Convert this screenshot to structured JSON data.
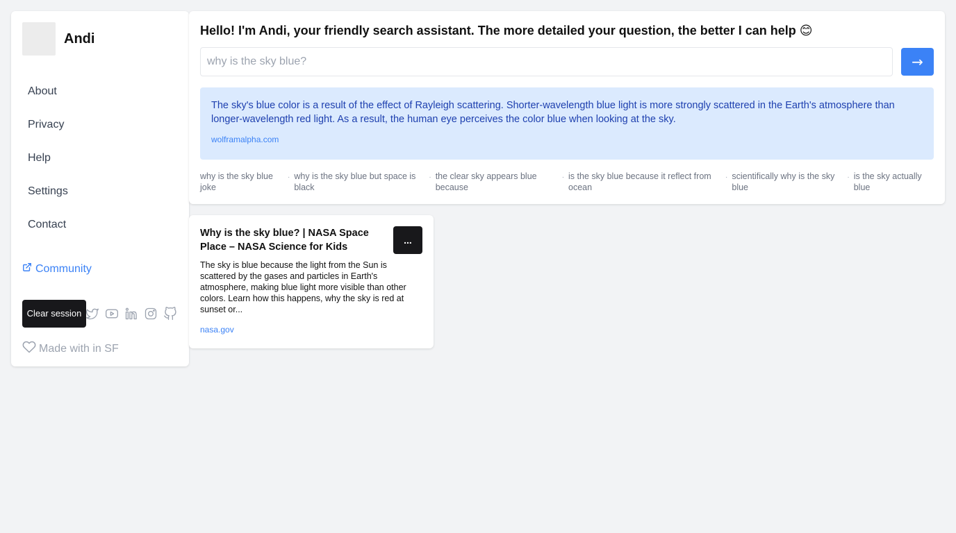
{
  "sidebar": {
    "brand": "Andi",
    "nav": [
      "About",
      "Privacy",
      "Help",
      "Settings",
      "Contact"
    ],
    "community": "Community",
    "clear_session": "Clear session",
    "socials": [
      "twitter-icon",
      "youtube-icon",
      "linkedin-icon",
      "instagram-icon",
      "github-icon"
    ],
    "made_with": "Made with in SF"
  },
  "search": {
    "greeting": "Hello! I'm Andi, your friendly search assistant. The more detailed your question, the better I can help 😊",
    "placeholder": "why is the sky blue?",
    "submit_label": "→",
    "answer": {
      "text": "The sky's blue color is a result of the effect of Rayleigh scattering. Shorter-wavelength blue light is more strongly scattered in the Earth's atmosphere than longer-wavelength red light. As a result, the human eye perceives the color blue when looking at the sky.",
      "source": "wolframalpha.com"
    },
    "related": [
      "why is the sky blue joke",
      "why is the sky blue but space is black",
      "the clear sky appears blue because",
      "is the sky blue because it reflect from ocean",
      "scientifically why is the sky blue",
      "is the sky actually blue"
    ]
  },
  "result": {
    "title": "Why is the sky blue? | NASA Space Place – NASA Science for Kids",
    "snippet": "The sky is blue because the light from the Sun is scattered by the gases and particles in Earth's atmosphere, making blue light more visible than other colors. Learn how this happens, why the sky is red at sunset or...",
    "source": "nasa.gov",
    "more_label": "..."
  },
  "colors": {
    "accent": "#3b82f6",
    "answer_bg": "#dbeafe",
    "answer_text": "#1e40af",
    "dark_button": "#18181b",
    "page_bg": "#f2f3f5"
  }
}
